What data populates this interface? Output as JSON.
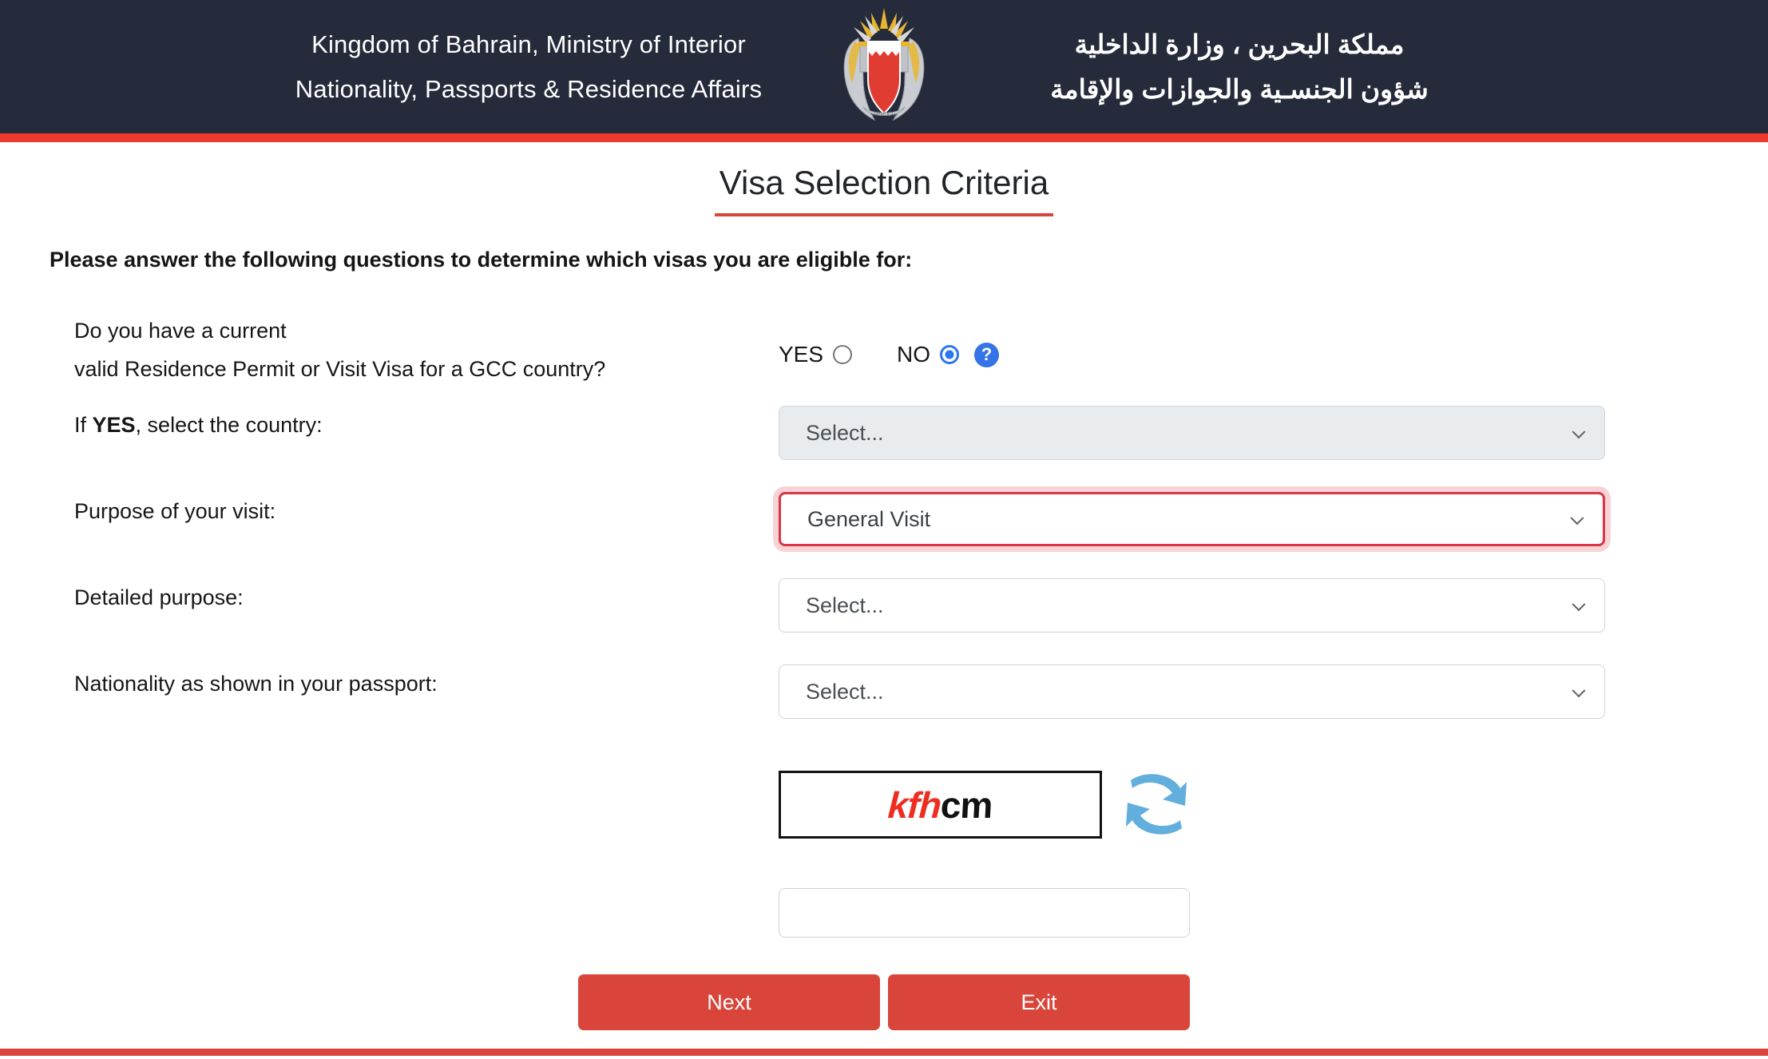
{
  "header": {
    "english_line1": "Kingdom of Bahrain, Ministry of Interior",
    "english_line2": "Nationality, Passports & Residence Affairs",
    "arabic_line1": "مملكة البحرين ، وزارة الداخلية",
    "arabic_line2": "شؤون الجنسـية والجوازات والإقامة",
    "emblem_name": "bahrain-coat-of-arms",
    "background_color": "#252B3B",
    "accent_rule_color": "#EE3A2A"
  },
  "page": {
    "title": "Visa Selection Criteria",
    "title_underline_color": "#D9443A",
    "intro": "Please answer the following questions to determine which visas you are eligible for:"
  },
  "form": {
    "gcc_question": {
      "label_line1": "Do you have a current",
      "label_line2": "valid Residence Permit or Visit Visa for a GCC country?",
      "yes_label": "YES",
      "no_label": "NO",
      "selected": "NO",
      "help_glyph": "?",
      "radio_accent_color": "#2A77EE",
      "help_color": "#3573E6"
    },
    "country": {
      "label_prefix": "If ",
      "label_strong": "YES",
      "label_suffix": ", select the country:",
      "value": "Select...",
      "disabled": true
    },
    "purpose": {
      "label": "Purpose of your visit:",
      "value": "General Visit",
      "invalid": true,
      "invalid_color": "#DC3545"
    },
    "detailed_purpose": {
      "label": "Detailed purpose:",
      "value": "Select..."
    },
    "nationality": {
      "label": "Nationality as shown in your passport:",
      "value": "Select..."
    },
    "captcha": {
      "text_red": "kfh",
      "text_black": "cm",
      "refresh_icon_name": "refresh-icon",
      "refresh_icon_color": "#62AEDC",
      "input_value": "",
      "input_placeholder": ""
    }
  },
  "actions": {
    "next_label": "Next",
    "exit_label": "Exit",
    "button_color": "#D9453B"
  },
  "footer": {
    "rule_color": "#D9453B"
  }
}
